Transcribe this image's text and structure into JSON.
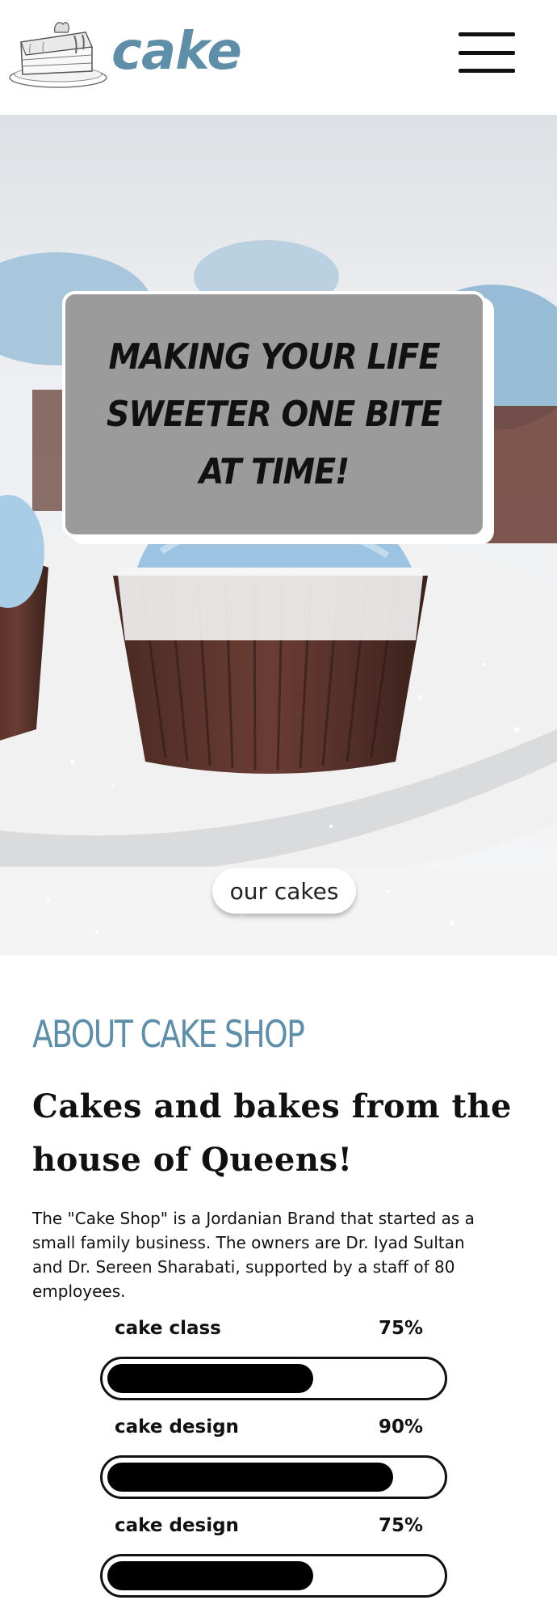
{
  "header": {
    "logo_text": "cake",
    "logo_icon": "cake-illustration",
    "menu_icon": "hamburger-menu-icon",
    "brand_color": "#5f8fa8"
  },
  "hero": {
    "tagline": "MAKING YOUR LIFE SWEETER ONE BITE AT TIME!",
    "button_label": "our cakes",
    "image": "blue-frosted-cupcakes-photo"
  },
  "about": {
    "heading": "ABOUT CAKE SHOP",
    "title": "Cakes and bakes from the house of Queens!",
    "text": "The \"Cake Shop\" is a Jordanian Brand that started as a small family business. The owners are Dr. Iyad Sultan and Dr. Sereen Sharabati, supported by a staff of 80 employees.",
    "heading_color": "#5f8fa8",
    "skills": [
      {
        "name": "cake class",
        "percent": "75%",
        "value": 0.75
      },
      {
        "name": "cake design",
        "percent": "90%",
        "value": 0.9
      },
      {
        "name": "cake design",
        "percent": "75%",
        "value": 0.75
      }
    ]
  }
}
